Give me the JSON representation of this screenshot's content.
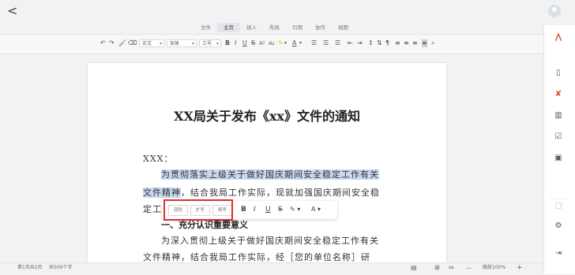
{
  "window": {
    "back_label": "<"
  },
  "menu": {
    "items": [
      "文件",
      "主页",
      "插入",
      "布局",
      "引用",
      "协作",
      "视图"
    ],
    "active": "主页"
  },
  "toolbar": {
    "style_value": "正文",
    "font_value": "宋体",
    "size_value": "三号",
    "bold": "B",
    "italic": "I",
    "underline": "U",
    "strike": "S",
    "superscript": "A²",
    "subscript": "A₂"
  },
  "document": {
    "title": "XX局关于发布《xx》文件的通知",
    "address": "XXX：",
    "p1_line1_sel": "为贯彻落实上级关于做好国庆期间安全稳定工作有关",
    "p1_line2_sel": "文件精神",
    "p1_line2_rest": "，结合我局工作实际，现就加强国庆期间安全稳",
    "p1_line3": "定工",
    "heading1": "一、充分认识重要意义",
    "p2_line1": "为深入贯彻上级关于做好国庆期间安全稳定工作有关",
    "p2_line2": "文件精神，结合我局工作实际，经［您的单位名称］研"
  },
  "floating_toolbar": {
    "ai_buttons": [
      "润色",
      "扩写",
      "续写"
    ],
    "bold": "B",
    "italic": "I",
    "underline": "U",
    "strike": "S",
    "highlight": "✎ ▾",
    "font_color": "A ▾"
  },
  "status": {
    "page_info": "第1页共2页",
    "word_count": "共509个字",
    "zoom": "缩放100%",
    "zoom_out": "—",
    "zoom_in": "+"
  },
  "colors": {
    "highlight": "#c9d8f0",
    "annotation_box": "#e0302b",
    "brand": "#e8442a"
  }
}
